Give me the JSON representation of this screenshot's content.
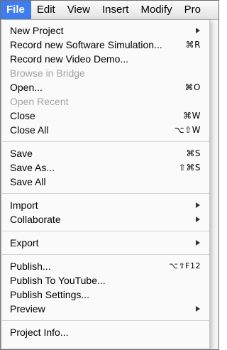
{
  "menubar": {
    "items": [
      "File",
      "Edit",
      "View",
      "Insert",
      "Modify",
      "Pro"
    ]
  },
  "menu": {
    "group1": {
      "new_project": "New Project",
      "record_sim": "Record new Software Simulation...",
      "record_sim_shortcut": "⌘R",
      "record_video": "Record new Video Demo...",
      "browse_bridge": "Browse in Bridge",
      "open": "Open...",
      "open_shortcut": "⌘O",
      "open_recent": "Open Recent",
      "close": "Close",
      "close_shortcut": "⌘W",
      "close_all": "Close All",
      "close_all_shortcut": "⌥⇧W"
    },
    "group2": {
      "save": "Save",
      "save_shortcut": "⌘S",
      "save_as": "Save As...",
      "save_as_shortcut": "⇧⌘S",
      "save_all": "Save All"
    },
    "group3": {
      "import": "Import",
      "collaborate": "Collaborate"
    },
    "group4": {
      "export": "Export"
    },
    "group5": {
      "publish": "Publish...",
      "publish_shortcut": "⌥⇧F12",
      "publish_youtube": "Publish To YouTube...",
      "publish_settings": "Publish Settings...",
      "preview": "Preview"
    },
    "group6": {
      "project_info": "Project Info..."
    }
  },
  "colors": {
    "highlight": "#3e7cf0",
    "disabled_text": "#a3a3a3"
  }
}
